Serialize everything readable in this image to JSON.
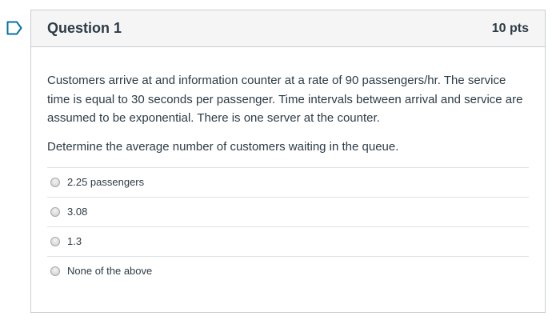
{
  "question": {
    "title": "Question 1",
    "points": "10 pts",
    "text": "Customers arrive at and information counter at a rate of 90 passengers/hr. The service time is equal to 30 seconds per passenger. Time intervals between arrival and service are assumed to be exponential.  There is one server at the counter.",
    "prompt": "Determine the average number of customers waiting in the queue.",
    "answers": [
      {
        "label": "2.25 passengers",
        "selected": false
      },
      {
        "label": "3.08",
        "selected": false
      },
      {
        "label": "1.3",
        "selected": false
      },
      {
        "label": "None of the above",
        "selected": false
      }
    ]
  },
  "colors": {
    "header_bg": "#f5f5f5",
    "border": "#c7cdd1",
    "text": "#2d3b45",
    "flag": "#0770a3"
  },
  "icons": {
    "flag": "flag-question-icon"
  }
}
